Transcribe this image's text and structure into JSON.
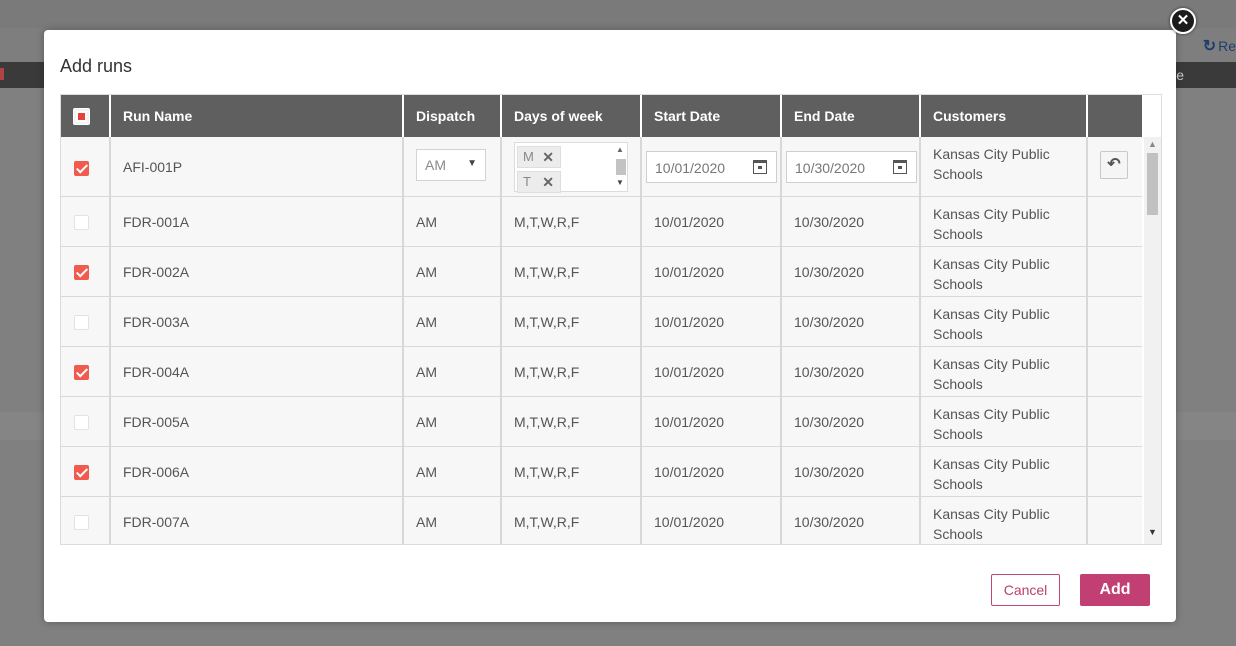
{
  "background": {
    "refresh_label": "Re",
    "header_partial_text": "e"
  },
  "modal": {
    "title": "Add runs",
    "close_glyph": "✕",
    "columns": [
      "Run Name",
      "Dispatch",
      "Days of week",
      "Start Date",
      "End Date",
      "Customers"
    ],
    "header_checkbox_state": "partial",
    "edit_row": {
      "checked": true,
      "run_name": "AFI-001P",
      "dispatch": "AM",
      "days_tags": [
        "M",
        "T"
      ],
      "start_date": "10/01/2020",
      "end_date": "10/30/2020",
      "customer": "Kansas City Public Schools"
    },
    "rows": [
      {
        "checked": false,
        "run_name": "FDR-001A",
        "dispatch": "AM",
        "days": "M,T,W,R,F",
        "start_date": "10/01/2020",
        "end_date": "10/30/2020",
        "customer": "Kansas City Public Schools"
      },
      {
        "checked": true,
        "run_name": "FDR-002A",
        "dispatch": "AM",
        "days": "M,T,W,R,F",
        "start_date": "10/01/2020",
        "end_date": "10/30/2020",
        "customer": "Kansas City Public Schools"
      },
      {
        "checked": false,
        "run_name": "FDR-003A",
        "dispatch": "AM",
        "days": "M,T,W,R,F",
        "start_date": "10/01/2020",
        "end_date": "10/30/2020",
        "customer": "Kansas City Public Schools"
      },
      {
        "checked": true,
        "run_name": "FDR-004A",
        "dispatch": "AM",
        "days": "M,T,W,R,F",
        "start_date": "10/01/2020",
        "end_date": "10/30/2020",
        "customer": "Kansas City Public Schools"
      },
      {
        "checked": false,
        "run_name": "FDR-005A",
        "dispatch": "AM",
        "days": "M,T,W,R,F",
        "start_date": "10/01/2020",
        "end_date": "10/30/2020",
        "customer": "Kansas City Public Schools"
      },
      {
        "checked": true,
        "run_name": "FDR-006A",
        "dispatch": "AM",
        "days": "M,T,W,R,F",
        "start_date": "10/01/2020",
        "end_date": "10/30/2020",
        "customer": "Kansas City Public Schools"
      },
      {
        "checked": false,
        "run_name": "FDR-007A",
        "dispatch": "AM",
        "days": "M,T,W,R,F",
        "start_date": "10/01/2020",
        "end_date": "10/30/2020",
        "customer": "Kansas City Public Schools"
      }
    ],
    "cancel_label": "Cancel",
    "add_label": "Add",
    "colors": {
      "accent": "#c13f72",
      "checkbox": "#f15a4f",
      "header_bg": "#5f5f5f"
    }
  }
}
